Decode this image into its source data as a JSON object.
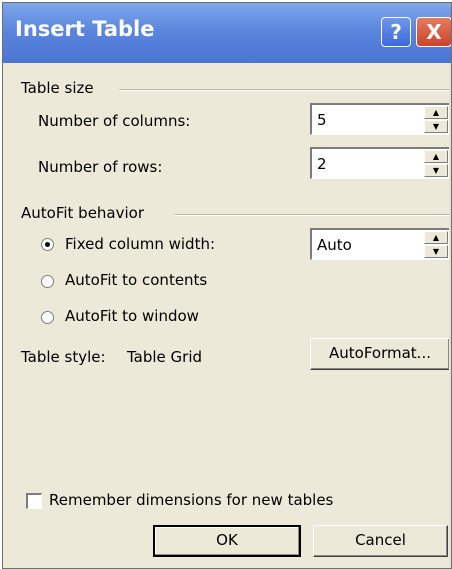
{
  "title": "Insert Table",
  "title_buttons": {
    "help": "?",
    "close": "X"
  },
  "table_size": {
    "heading": "Table size",
    "columns_label": "Number of columns:",
    "columns_value": "5",
    "rows_label": "Number of rows:",
    "rows_value": "2"
  },
  "autofit": {
    "heading": "AutoFit behavior",
    "options": [
      {
        "label": "Fixed column width:",
        "selected": true
      },
      {
        "label": "AutoFit to contents",
        "selected": false
      },
      {
        "label": "AutoFit to window",
        "selected": false
      }
    ],
    "width_value": "Auto"
  },
  "table_style": {
    "label": "Table style:",
    "value": "Table Grid",
    "autoformat_button": "AutoFormat..."
  },
  "remember": {
    "label": "Remember dimensions for new tables",
    "checked": false
  },
  "buttons": {
    "ok": "OK",
    "cancel": "Cancel"
  }
}
